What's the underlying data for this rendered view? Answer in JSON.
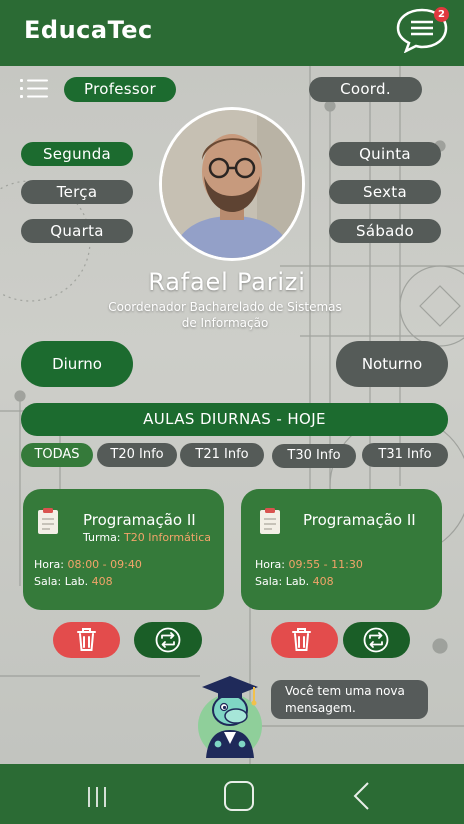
{
  "app": {
    "title": "EducaTec",
    "notification_count": "2"
  },
  "roles": {
    "professor": "Professor",
    "coord": "Coord."
  },
  "days": [
    "Segunda",
    "Terça",
    "Quarta",
    "Quinta",
    "Sexta",
    "Sábado"
  ],
  "profile": {
    "name": "Rafael Parizi",
    "role_line1": "Coordenador Bacharelado de Sistemas",
    "role_line2": "de Informação"
  },
  "shifts": {
    "day": "Diurno",
    "night": "Noturno"
  },
  "banner": "AULAS DIURNAS - HOJE",
  "filters": [
    "TODAS",
    "T20 Info",
    "T21 Info",
    "T30 Info",
    "T31 Info"
  ],
  "classes": [
    {
      "title": "Programação II",
      "turma_label": "Turma:",
      "turma_value": "T20 Informática",
      "hora_label": "Hora:",
      "hora_value": "08:00 - 09:40",
      "sala_label": "Sala: Lab.",
      "sala_value": "408"
    },
    {
      "title": "Programação II",
      "hora_label": "Hora:",
      "hora_value": "09:55 - 11:30",
      "sala_label": "Sala: Lab.",
      "sala_value": "408"
    }
  ],
  "toast": {
    "line1": "Você tem uma nova",
    "line2": "mensagem."
  },
  "colors": {
    "primary": "#2b6b34",
    "pill_active": "#1c6b2f",
    "pill_inactive": "#555b58",
    "card": "#357a3a",
    "delete": "#e34c4c",
    "accent_text": "#f2a46a",
    "badge": "#e0393e"
  },
  "icons": {
    "menu": "hamburger-menu-icon",
    "chat": "chat-bubble-icon",
    "delete": "trash-icon",
    "swap": "swap-icon",
    "clipboard": "clipboard-icon",
    "nav_recent": "recent-apps-icon",
    "nav_home": "home-icon",
    "nav_back": "back-icon"
  }
}
